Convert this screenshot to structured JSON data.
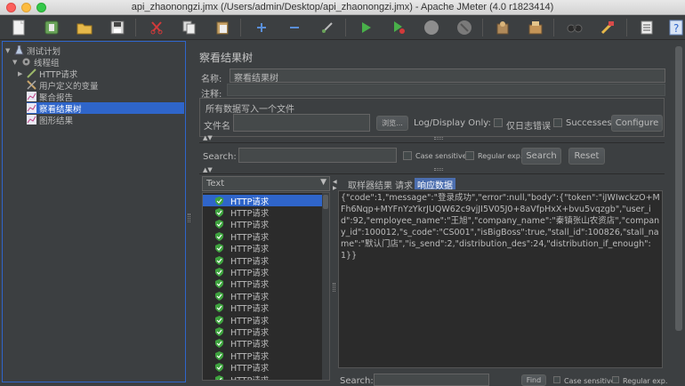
{
  "window": {
    "title": "api_zhaonongzi.jmx (/Users/admin/Desktop/api_zhaonongzi.jmx) - Apache JMeter (4.0 r1823414)"
  },
  "tree": {
    "items": [
      {
        "label": "测试计划"
      },
      {
        "label": "线程组"
      },
      {
        "label": "HTTP请求"
      },
      {
        "label": "用户定义的变量"
      },
      {
        "label": "聚合报告"
      },
      {
        "label": "察看结果树"
      },
      {
        "label": "图形结果"
      }
    ]
  },
  "panel": {
    "title": "察看结果树",
    "name_label": "名称:",
    "name_value": "察看结果树",
    "comment_label": "注释:",
    "comment_value": "",
    "fileset_legend": "所有数据写入一个文件",
    "filename_label": "文件名",
    "browse_label": "浏览...",
    "log_display_label": "Log/Display Only:",
    "errors_only_label": "仅日志错误",
    "successes_label": "Successes",
    "configure_label": "Configure"
  },
  "search": {
    "label": "Search:",
    "value": "",
    "case_sensitive_label": "Case sensitive",
    "regex_label": "Regular exp.",
    "search_button": "Search",
    "reset_button": "Reset"
  },
  "results": {
    "renderer": "Text",
    "items": [
      "HTTP请求",
      "HTTP请求",
      "HTTP请求",
      "HTTP请求",
      "HTTP请求",
      "HTTP请求",
      "HTTP请求",
      "HTTP请求",
      "HTTP请求",
      "HTTP请求",
      "HTTP请求",
      "HTTP请求",
      "HTTP请求",
      "HTTP请求",
      "HTTP请求",
      "HTTP请求"
    ]
  },
  "detail": {
    "tabs": [
      "取样器结果",
      "请求",
      "响应数据"
    ],
    "active_tab": 2,
    "response_text": "{\"code\":1,\"message\":\"登录成功\",\"error\":null,\"body\":{\"token\":\"iJWIwckzO+MFh6Nqp+MYFnYzYkrJUQW62c9vjJI5V05J0+8aVfpHxX+bvu5vqzgb\",\"user_id\":92,\"employee_name\":\"王旭\",\"company_name\":\"秦镇张山农资店\",\"company_id\":100012,\"s_code\":\"CS001\",\"isBigBoss\":true,\"stall_id\":100826,\"stall_name\":\"默认门店\",\"is_send\":2,\"distribution_des\":24,\"distribution_if_enough\":1}}",
    "search_label": "Search:",
    "find_button": "Find",
    "case_sensitive_label": "Case sensitive",
    "regex_label": "Regular exp."
  },
  "colors": {
    "selection": "#2f65ca",
    "background": "#3c3f41",
    "success_shield": "#3fa33f"
  }
}
